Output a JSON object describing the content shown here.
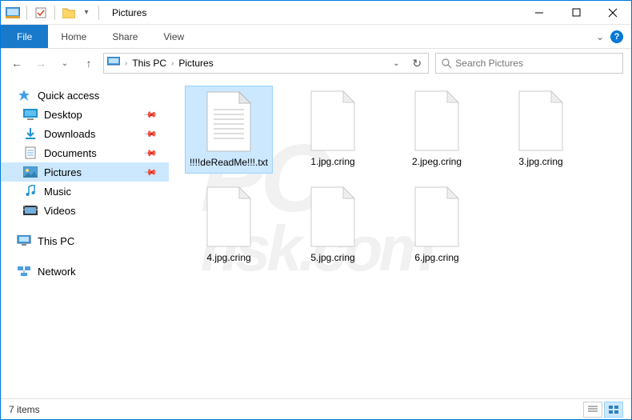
{
  "window": {
    "title": "Pictures"
  },
  "ribbon": {
    "file": "File",
    "tabs": [
      "Home",
      "Share",
      "View"
    ]
  },
  "breadcrumbs": {
    "items": [
      "This PC",
      "Pictures"
    ]
  },
  "search": {
    "placeholder": "Search Pictures"
  },
  "sidebar": {
    "quick_access": "Quick access",
    "items": [
      {
        "label": "Desktop",
        "pinned": true,
        "icon": "desktop"
      },
      {
        "label": "Downloads",
        "pinned": true,
        "icon": "downloads"
      },
      {
        "label": "Documents",
        "pinned": true,
        "icon": "documents"
      },
      {
        "label": "Pictures",
        "pinned": true,
        "icon": "pictures",
        "selected": true
      },
      {
        "label": "Music",
        "pinned": false,
        "icon": "music"
      },
      {
        "label": "Videos",
        "pinned": false,
        "icon": "videos"
      }
    ],
    "this_pc": "This PC",
    "network": "Network"
  },
  "files": [
    {
      "name": "!!!!deReadMe!!!.txt",
      "type": "txt",
      "selected": true
    },
    {
      "name": "1.jpg.cring",
      "type": "blank"
    },
    {
      "name": "2.jpeg.cring",
      "type": "blank"
    },
    {
      "name": "3.jpg.cring",
      "type": "blank"
    },
    {
      "name": "4.jpg.cring",
      "type": "blank"
    },
    {
      "name": "5.jpg.cring",
      "type": "blank"
    },
    {
      "name": "6.jpg.cring",
      "type": "blank"
    }
  ],
  "status": {
    "count": "7 items"
  }
}
